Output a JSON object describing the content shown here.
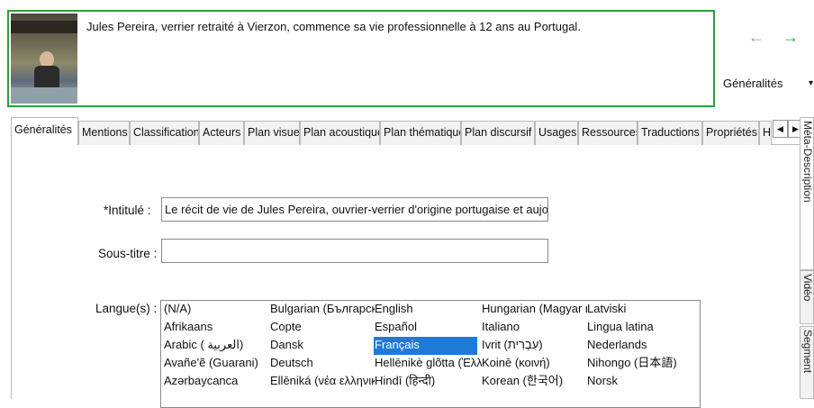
{
  "header": {
    "summary": "Jules Pereira, verrier retraité à Vierzon, commence sa vie professionnelle à 12 ans au Portugal.",
    "nav_back": "←",
    "nav_forward": "→",
    "section_value": "Généralités",
    "section_caret": "▾"
  },
  "tabs": [
    {
      "label": "Généralités",
      "active": true
    },
    {
      "label": "Mentions"
    },
    {
      "label": "Classification"
    },
    {
      "label": "Acteurs"
    },
    {
      "label": "Plan visuel"
    },
    {
      "label": "Plan acoustique"
    },
    {
      "label": "Plan thématique"
    },
    {
      "label": "Plan discursif"
    },
    {
      "label": "Usages"
    },
    {
      "label": "Ressources"
    },
    {
      "label": "Traductions"
    },
    {
      "label": "Propriétés"
    },
    {
      "label": "H"
    }
  ],
  "tab_scroll": {
    "left": "◀",
    "right": "▶"
  },
  "form": {
    "intitule_label": "*Intitulé :",
    "intitule_value": "Le récit de vie de Jules Pereira, ouvrier-verrier d'origine portugaise et aujourd'hui",
    "soustitre_label": "Sous-titre :",
    "soustitre_value": "",
    "langues_label": "Langue(s) :"
  },
  "languages": {
    "columns": [
      [
        "(N/A)",
        "Afrikaans",
        "Arabic ( العربية)",
        "Avañe'ẽ (Guarani)",
        "Azərbaycanca"
      ],
      [
        "Bulgarian (Български)",
        "Copte",
        "Dansk",
        "Deutsch",
        "Ellēniká (νέα ελληνικά)"
      ],
      [
        "English",
        "Español",
        "Français",
        "Hellēnikè glõtta (Ἑλληνική)",
        "Hindī (हिन्दी)"
      ],
      [
        "Hungarian (Magyar nyelv)",
        "Italiano",
        "Ivrit (עִבְרִית)",
        "Koinē (κοινή)",
        "Korean (한국어)"
      ],
      [
        "Latviski",
        "Lingua latina",
        "Nederlands",
        "Nihongo (日本語)",
        "Norsk"
      ]
    ],
    "selected": "Français"
  },
  "side_tabs": [
    "Méta-Description",
    "Vidéo",
    "Segment"
  ]
}
